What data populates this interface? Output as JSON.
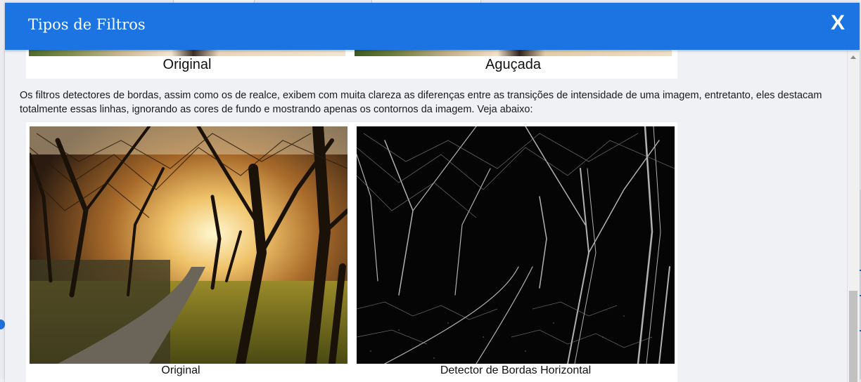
{
  "modal": {
    "title": "Tipos de Filtros",
    "close_label": "X"
  },
  "top_figure": {
    "left_caption": "Original",
    "right_caption": "Aguçada"
  },
  "paragraph": "Os filtros detectores de bordas, assim como os de realce, exibem com muita clareza as diferenças entre as transições de intensidade de uma imagem, entretanto, eles destacam totalmente essas linhas, ignorando as cores de fundo e mostrando apenas os contornos da imagem. Veja abaixo:",
  "main_figure": {
    "left_caption": "Original",
    "right_caption": "Detector de Bordas Horizontal"
  },
  "colors": {
    "header": "#1b74e1",
    "background": "#f0f1f5"
  },
  "icons": {
    "close": "close-icon"
  }
}
